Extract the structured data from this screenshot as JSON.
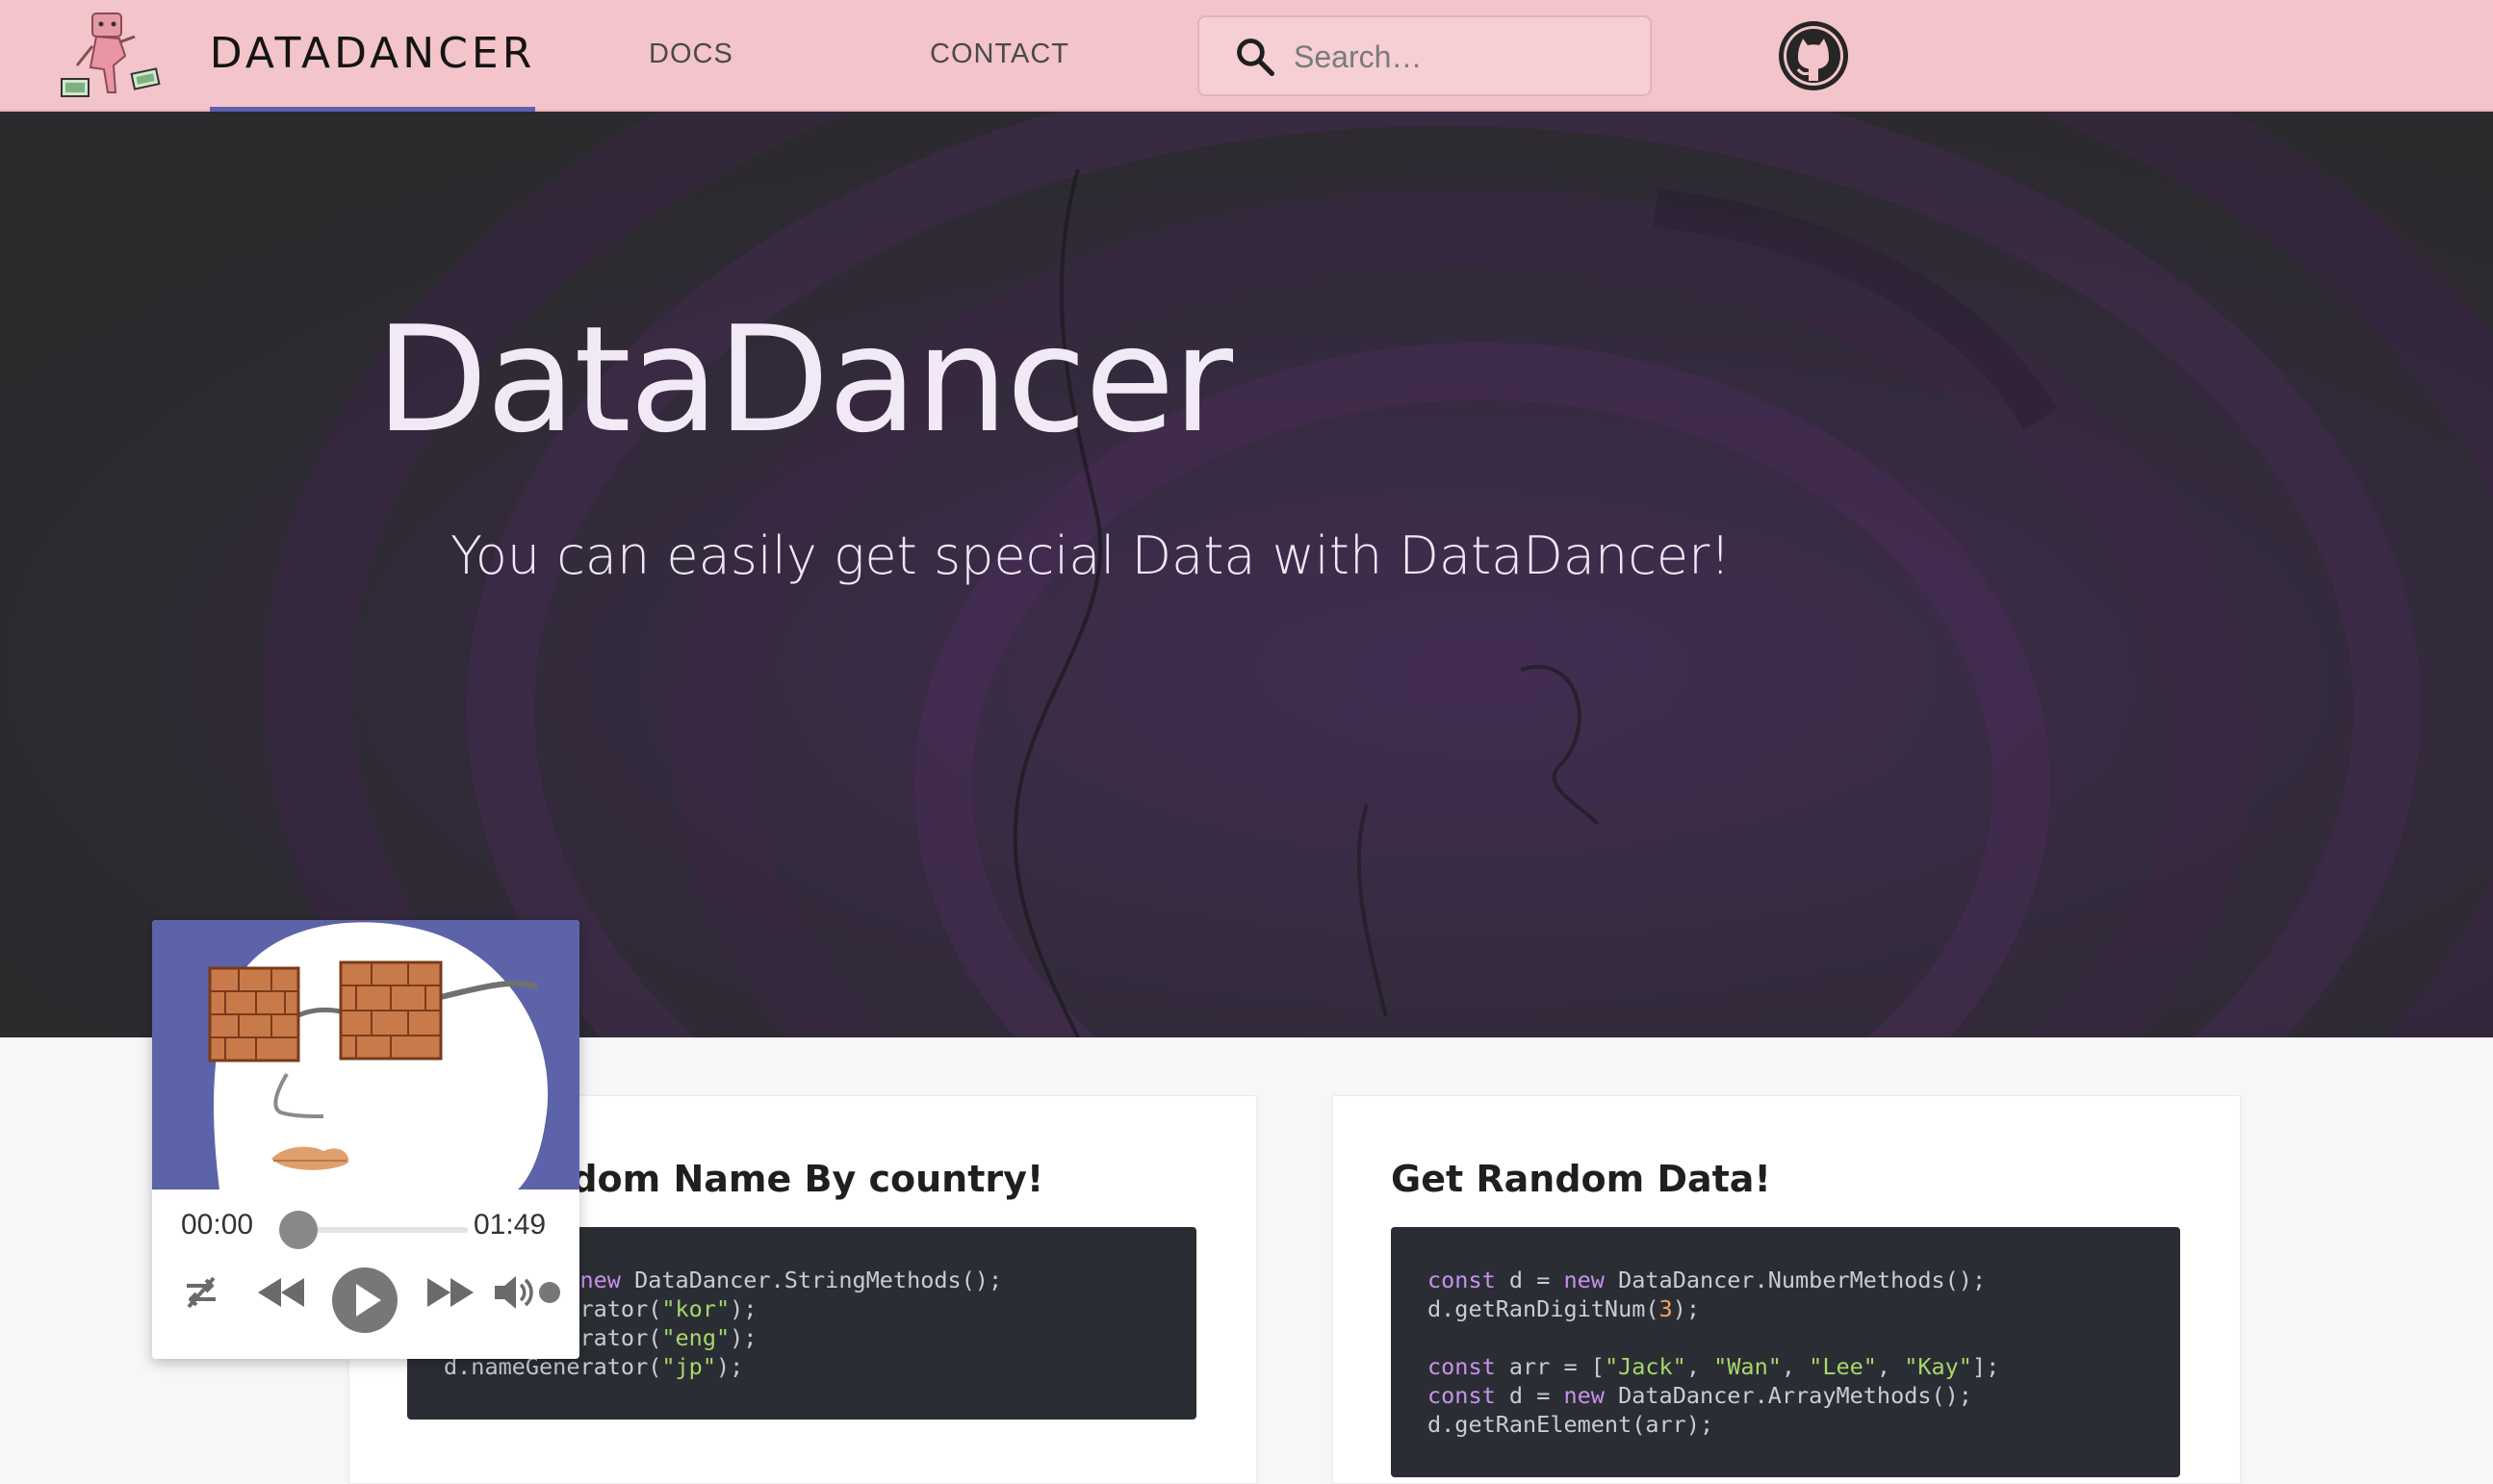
{
  "header": {
    "brand": "DATADANCER",
    "nav": [
      {
        "label": "DOCS"
      },
      {
        "label": "CONTACT"
      }
    ],
    "search": {
      "placeholder": "Search…"
    },
    "icons": {
      "search": "search-icon",
      "github": "github-icon",
      "logo": "datadancer-logo"
    }
  },
  "hero": {
    "title": "DataDancer",
    "subtitle": "You can easily get special Data with DataDancer!"
  },
  "cards": [
    {
      "title": "Get Random Name By country!",
      "code": [
        "const d = new DataDancer.StringMethods();",
        "d.nameGenerator(\"kor\");",
        "d.nameGenerator(\"eng\");",
        "d.nameGenerator(\"jp\");"
      ]
    },
    {
      "title": "Get Random Data!",
      "code": [
        "const d = new DataDancer.NumberMethods();",
        "d.getRanDigitNum(3);",
        "",
        "const arr = [\"Jack\", \"Wan\", \"Lee\", \"Kay\"];",
        "const d = new DataDancer.ArrayMethods();",
        "d.getRanElement(arr);"
      ]
    }
  ],
  "player": {
    "current_time": "00:00",
    "total_time": "01:49",
    "progress": 0,
    "controls": [
      "repeat-icon",
      "rewind-icon",
      "play-icon",
      "fast-forward-icon",
      "volume-icon"
    ]
  },
  "colors": {
    "header_bg": "#f3c4c9",
    "brand_underline": "#5e5fb0",
    "hero_bg": "#2b2a2d",
    "code_bg": "#2b2d34",
    "code_keyword": "#c792ea",
    "code_string": "#a6d86a",
    "code_number": "#f5a35c"
  }
}
